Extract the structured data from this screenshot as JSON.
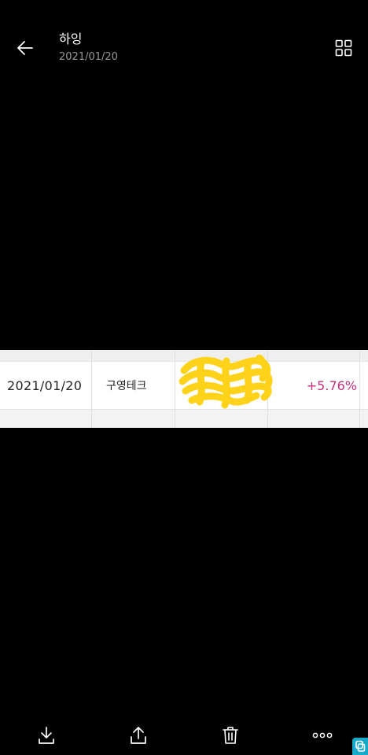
{
  "header": {
    "title": "하잉",
    "subtitle": "2021/01/20",
    "back_icon": "arrow-left-icon",
    "grid_icon": "grid-icon"
  },
  "image": {
    "row": {
      "date": "2021/01/20",
      "name": "구영테크",
      "change": "+5.76%"
    },
    "colors": {
      "change": "#c2307a",
      "scribble": "#ffd21a"
    }
  },
  "bottom_bar": {
    "icons": [
      "download-icon",
      "share-icon",
      "trash-icon",
      "more-icon"
    ]
  }
}
